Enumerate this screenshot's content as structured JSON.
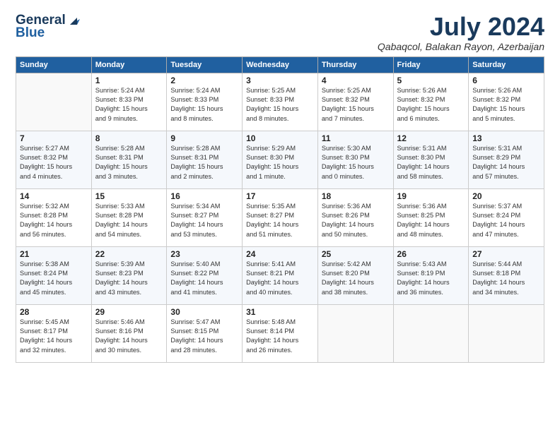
{
  "header": {
    "logo_line1": "General",
    "logo_line2": "Blue",
    "month": "July 2024",
    "location": "Qabaqcol, Balakan Rayon, Azerbaijan"
  },
  "weekdays": [
    "Sunday",
    "Monday",
    "Tuesday",
    "Wednesday",
    "Thursday",
    "Friday",
    "Saturday"
  ],
  "weeks": [
    [
      {
        "day": "",
        "detail": ""
      },
      {
        "day": "1",
        "detail": "Sunrise: 5:24 AM\nSunset: 8:33 PM\nDaylight: 15 hours\nand 9 minutes."
      },
      {
        "day": "2",
        "detail": "Sunrise: 5:24 AM\nSunset: 8:33 PM\nDaylight: 15 hours\nand 8 minutes."
      },
      {
        "day": "3",
        "detail": "Sunrise: 5:25 AM\nSunset: 8:33 PM\nDaylight: 15 hours\nand 8 minutes."
      },
      {
        "day": "4",
        "detail": "Sunrise: 5:25 AM\nSunset: 8:32 PM\nDaylight: 15 hours\nand 7 minutes."
      },
      {
        "day": "5",
        "detail": "Sunrise: 5:26 AM\nSunset: 8:32 PM\nDaylight: 15 hours\nand 6 minutes."
      },
      {
        "day": "6",
        "detail": "Sunrise: 5:26 AM\nSunset: 8:32 PM\nDaylight: 15 hours\nand 5 minutes."
      }
    ],
    [
      {
        "day": "7",
        "detail": "Sunrise: 5:27 AM\nSunset: 8:32 PM\nDaylight: 15 hours\nand 4 minutes."
      },
      {
        "day": "8",
        "detail": "Sunrise: 5:28 AM\nSunset: 8:31 PM\nDaylight: 15 hours\nand 3 minutes."
      },
      {
        "day": "9",
        "detail": "Sunrise: 5:28 AM\nSunset: 8:31 PM\nDaylight: 15 hours\nand 2 minutes."
      },
      {
        "day": "10",
        "detail": "Sunrise: 5:29 AM\nSunset: 8:30 PM\nDaylight: 15 hours\nand 1 minute."
      },
      {
        "day": "11",
        "detail": "Sunrise: 5:30 AM\nSunset: 8:30 PM\nDaylight: 15 hours\nand 0 minutes."
      },
      {
        "day": "12",
        "detail": "Sunrise: 5:31 AM\nSunset: 8:30 PM\nDaylight: 14 hours\nand 58 minutes."
      },
      {
        "day": "13",
        "detail": "Sunrise: 5:31 AM\nSunset: 8:29 PM\nDaylight: 14 hours\nand 57 minutes."
      }
    ],
    [
      {
        "day": "14",
        "detail": "Sunrise: 5:32 AM\nSunset: 8:28 PM\nDaylight: 14 hours\nand 56 minutes."
      },
      {
        "day": "15",
        "detail": "Sunrise: 5:33 AM\nSunset: 8:28 PM\nDaylight: 14 hours\nand 54 minutes."
      },
      {
        "day": "16",
        "detail": "Sunrise: 5:34 AM\nSunset: 8:27 PM\nDaylight: 14 hours\nand 53 minutes."
      },
      {
        "day": "17",
        "detail": "Sunrise: 5:35 AM\nSunset: 8:27 PM\nDaylight: 14 hours\nand 51 minutes."
      },
      {
        "day": "18",
        "detail": "Sunrise: 5:36 AM\nSunset: 8:26 PM\nDaylight: 14 hours\nand 50 minutes."
      },
      {
        "day": "19",
        "detail": "Sunrise: 5:36 AM\nSunset: 8:25 PM\nDaylight: 14 hours\nand 48 minutes."
      },
      {
        "day": "20",
        "detail": "Sunrise: 5:37 AM\nSunset: 8:24 PM\nDaylight: 14 hours\nand 47 minutes."
      }
    ],
    [
      {
        "day": "21",
        "detail": "Sunrise: 5:38 AM\nSunset: 8:24 PM\nDaylight: 14 hours\nand 45 minutes."
      },
      {
        "day": "22",
        "detail": "Sunrise: 5:39 AM\nSunset: 8:23 PM\nDaylight: 14 hours\nand 43 minutes."
      },
      {
        "day": "23",
        "detail": "Sunrise: 5:40 AM\nSunset: 8:22 PM\nDaylight: 14 hours\nand 41 minutes."
      },
      {
        "day": "24",
        "detail": "Sunrise: 5:41 AM\nSunset: 8:21 PM\nDaylight: 14 hours\nand 40 minutes."
      },
      {
        "day": "25",
        "detail": "Sunrise: 5:42 AM\nSunset: 8:20 PM\nDaylight: 14 hours\nand 38 minutes."
      },
      {
        "day": "26",
        "detail": "Sunrise: 5:43 AM\nSunset: 8:19 PM\nDaylight: 14 hours\nand 36 minutes."
      },
      {
        "day": "27",
        "detail": "Sunrise: 5:44 AM\nSunset: 8:18 PM\nDaylight: 14 hours\nand 34 minutes."
      }
    ],
    [
      {
        "day": "28",
        "detail": "Sunrise: 5:45 AM\nSunset: 8:17 PM\nDaylight: 14 hours\nand 32 minutes."
      },
      {
        "day": "29",
        "detail": "Sunrise: 5:46 AM\nSunset: 8:16 PM\nDaylight: 14 hours\nand 30 minutes."
      },
      {
        "day": "30",
        "detail": "Sunrise: 5:47 AM\nSunset: 8:15 PM\nDaylight: 14 hours\nand 28 minutes."
      },
      {
        "day": "31",
        "detail": "Sunrise: 5:48 AM\nSunset: 8:14 PM\nDaylight: 14 hours\nand 26 minutes."
      },
      {
        "day": "",
        "detail": ""
      },
      {
        "day": "",
        "detail": ""
      },
      {
        "day": "",
        "detail": ""
      }
    ]
  ]
}
